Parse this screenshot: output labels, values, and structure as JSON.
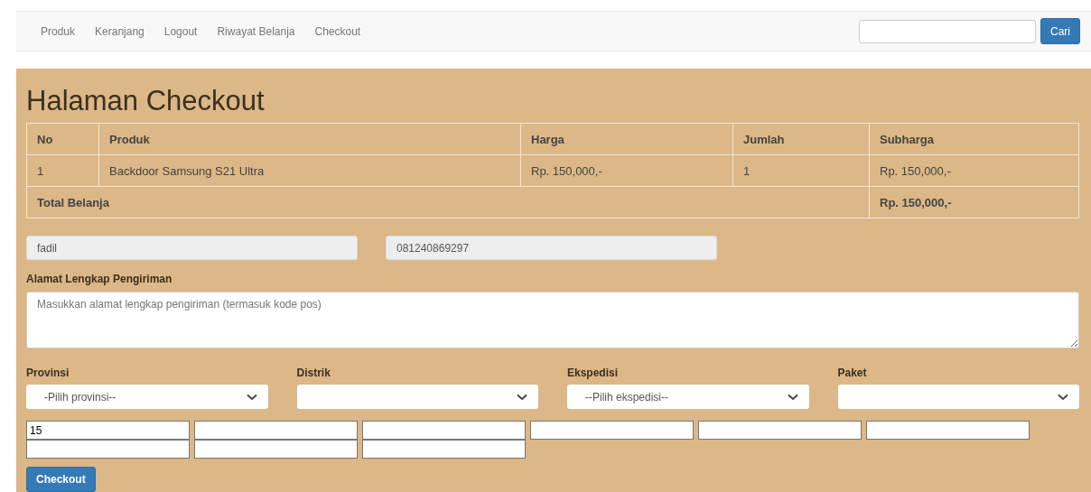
{
  "navbar": {
    "links": [
      {
        "label": "Produk"
      },
      {
        "label": "Keranjang"
      },
      {
        "label": "Logout"
      },
      {
        "label": "Riwayat Belanja"
      },
      {
        "label": "Checkout"
      }
    ],
    "search_button": "Cari"
  },
  "title": "Halaman Checkout",
  "table": {
    "columns": [
      "No",
      "Produk",
      "Harga",
      "Jumlah",
      "Subharga"
    ],
    "rows": [
      [
        "1",
        "Backdoor Samsung S21 Ultra",
        "Rp. 150,000,-",
        "1",
        "Rp. 150,000,-"
      ]
    ],
    "total": {
      "label": "Total Belanja",
      "value": "Rp. 150,000,-"
    }
  },
  "customer": {
    "name": "fadil",
    "phone": "081240869297"
  },
  "address": {
    "label": "Alamat Lengkap Pengiriman",
    "placeholder": "Masukkan alamat lengkap pengiriman (termasuk kode pos)"
  },
  "selects": [
    {
      "label": "Provinsi",
      "value": "-Pilih provinsi--"
    },
    {
      "label": "Distrik"
    },
    {
      "label": "Ekspedisi",
      "value": "--Pilih ekspedisi--"
    },
    {
      "label": "Paket"
    }
  ],
  "extra_fields": [
    {
      "kind": "filled",
      "value": "15"
    },
    {
      "kind": "empty"
    },
    {
      "kind": "empty"
    },
    {
      "kind": "empty"
    },
    {
      "kind": "empty"
    },
    {
      "kind": "empty"
    },
    {
      "kind": "empty"
    },
    {
      "kind": "empty"
    },
    {
      "kind": "empty"
    }
  ],
  "submit_button": "Checkout"
}
